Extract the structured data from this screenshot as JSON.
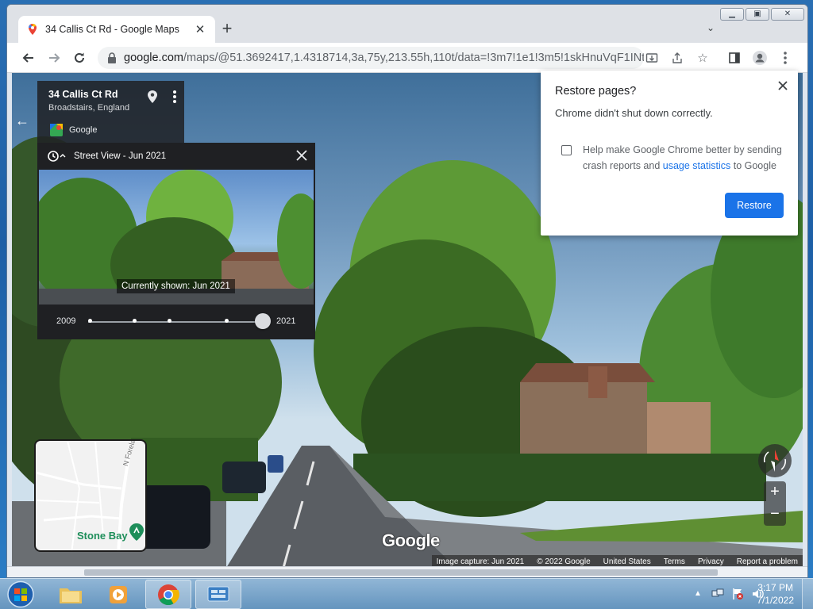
{
  "browser": {
    "tab_title": "34 Callis Ct Rd - Google Maps",
    "url_host": "google.com",
    "url_rest": "/maps/@51.3692417,1.4318714,3a,75y,213.55h,110t/data=!3m7!1e1!3m5!1skHnuVqF1INt..."
  },
  "place": {
    "name": "34 Callis Ct Rd",
    "subtitle": "Broadstairs, England",
    "brand": "Google"
  },
  "time_machine": {
    "header": "Street View - Jun 2021",
    "currently_shown": "Currently shown: Jun 2021",
    "start_year": "2009",
    "end_year": "2021",
    "selected_position": 1.0
  },
  "minimap": {
    "road_label": "N Foreland",
    "place_label": "Stone Bay"
  },
  "controls": {
    "zoom_in": "+",
    "zoom_out": "−"
  },
  "map_footer": {
    "image_capture": "Image capture: Jun 2021",
    "copyright": "© 2022 Google",
    "country": "United States",
    "terms": "Terms",
    "privacy": "Privacy",
    "report": "Report a problem"
  },
  "watermark": "Google",
  "restore_dialog": {
    "title": "Restore pages?",
    "message": "Chrome didn't shut down correctly.",
    "checkbox_text_before": "Help make Google Chrome better by sending crash reports and",
    "checkbox_link": "usage statistics",
    "checkbox_text_after": "to Google",
    "restore_button": "Restore"
  },
  "taskbar": {
    "time": "3:17 PM",
    "date": "7/1/2022"
  },
  "colors": {
    "chrome_blue": "#1a73e8",
    "minimap_place": "#1e8e5a"
  }
}
